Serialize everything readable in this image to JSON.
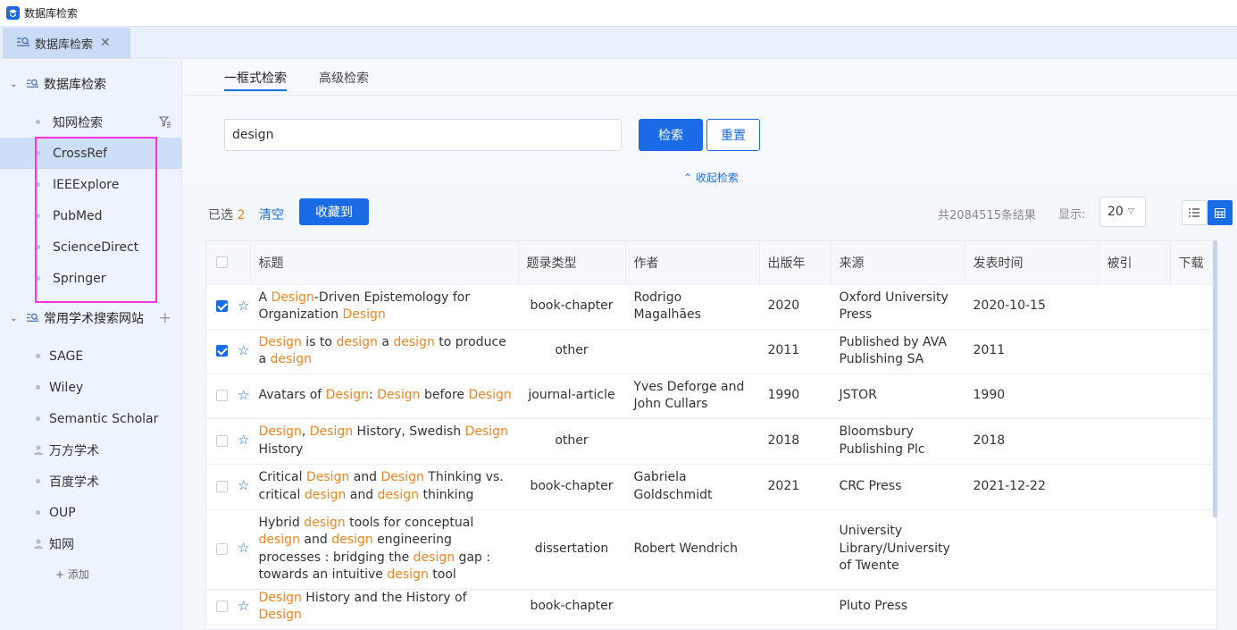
{
  "app": {
    "title": "数据库检索"
  },
  "tabs": [
    {
      "label": "数据库检索",
      "close": "✕"
    }
  ],
  "sidebar": {
    "group1": {
      "label": "数据库检索",
      "chevron": "⌄"
    },
    "items1": [
      {
        "label": "知网检索"
      },
      {
        "label": "CrossRef"
      },
      {
        "label": "IEEExplore"
      },
      {
        "label": "PubMed"
      },
      {
        "label": "ScienceDirect"
      },
      {
        "label": "Springer"
      }
    ],
    "group2": {
      "label": "常用学术搜索网站",
      "chevron": "⌄",
      "plus": "+"
    },
    "items2": [
      {
        "label": "SAGE"
      },
      {
        "label": "Wiley"
      },
      {
        "label": "Semantic Scholar"
      },
      {
        "label": "万方学术"
      },
      {
        "label": "百度学术"
      },
      {
        "label": "OUP"
      },
      {
        "label": "知网"
      }
    ],
    "add_label": "+ 添加"
  },
  "search": {
    "tabs": [
      {
        "label": "一框式检索"
      },
      {
        "label": "高级检索"
      }
    ],
    "query": "design",
    "search_button": "检索",
    "reset_button": "重置",
    "collapse_link": "⌃ 收起检索"
  },
  "toolbar": {
    "selected_label": "已选",
    "selected_count": "2",
    "clear": "清空",
    "favorite": "收藏到",
    "total": "共2084515条结果",
    "show_label": "显示:",
    "page_size": "20"
  },
  "table": {
    "headers": [
      "标题",
      "题录类型",
      "作者",
      "出版年",
      "来源",
      "发表时间",
      "被引",
      "下载"
    ],
    "rows": [
      {
        "checked": true,
        "title": [
          [
            "A ",
            0
          ],
          [
            "Design",
            1
          ],
          [
            "-Driven Epistemology for Organization ",
            0
          ],
          [
            "Design",
            1
          ]
        ],
        "type": "book-chapter",
        "author": "Rodrigo Magalhães",
        "year": "2020",
        "source": "Oxford University Press",
        "date": "2020-10-15",
        "cited": "",
        "download": ""
      },
      {
        "checked": true,
        "title": [
          [
            "Design",
            1
          ],
          [
            " is to ",
            0
          ],
          [
            "design",
            1
          ],
          [
            " a ",
            0
          ],
          [
            "design",
            1
          ],
          [
            " to produce a ",
            0
          ],
          [
            "design",
            1
          ]
        ],
        "type": "other",
        "author": "",
        "year": "2011",
        "source": "Published by AVA Publishing SA",
        "date": "2011",
        "cited": "",
        "download": ""
      },
      {
        "checked": false,
        "title": [
          [
            "Avatars of ",
            0
          ],
          [
            "Design",
            1
          ],
          [
            ": ",
            0
          ],
          [
            "Design",
            1
          ],
          [
            " before ",
            0
          ],
          [
            "Design",
            1
          ]
        ],
        "type": "journal-article",
        "author": "Yves Deforge and John Cullars",
        "year": "1990",
        "source": "JSTOR",
        "date": "1990",
        "cited": "",
        "download": ""
      },
      {
        "checked": false,
        "title": [
          [
            "Design",
            1
          ],
          [
            ", ",
            0
          ],
          [
            "Design",
            1
          ],
          [
            " History, Swedish ",
            0
          ],
          [
            "Design",
            1
          ],
          [
            " History",
            0
          ]
        ],
        "type": "other",
        "author": "",
        "year": "2018",
        "source": "Bloomsbury Publishing Plc",
        "date": "2018",
        "cited": "",
        "download": ""
      },
      {
        "checked": false,
        "title": [
          [
            "Critical ",
            0
          ],
          [
            "Design",
            1
          ],
          [
            " and ",
            0
          ],
          [
            "Design",
            1
          ],
          [
            " Thinking vs. critical ",
            0
          ],
          [
            "design",
            1
          ],
          [
            " and ",
            0
          ],
          [
            "design",
            1
          ],
          [
            " thinking",
            0
          ]
        ],
        "type": "book-chapter",
        "author": "Gabriela Goldschmidt",
        "year": "2021",
        "source": "CRC Press",
        "date": "2021-12-22",
        "cited": "",
        "download": ""
      },
      {
        "checked": false,
        "title": [
          [
            "Hybrid ",
            0
          ],
          [
            "design",
            1
          ],
          [
            " tools for conceptual ",
            0
          ],
          [
            "design",
            1
          ],
          [
            " and ",
            0
          ],
          [
            "design",
            1
          ],
          [
            " engineering processes : bridging the ",
            0
          ],
          [
            "design",
            1
          ],
          [
            " gap : towards an intuitive ",
            0
          ],
          [
            "design",
            1
          ],
          [
            " tool",
            0
          ]
        ],
        "type": "dissertation",
        "author": "Robert Wendrich",
        "year": "",
        "source": "University Library/University of Twente",
        "date": "",
        "cited": "",
        "download": ""
      },
      {
        "checked": false,
        "title": [
          [
            "Design",
            1
          ],
          [
            " History and the History of ",
            0
          ],
          [
            "Design",
            1
          ]
        ],
        "type": "book-chapter",
        "author": "",
        "year": "",
        "source": "Pluto Press",
        "date": "",
        "cited": "",
        "download": ""
      }
    ]
  },
  "colors": {
    "accent": "#1a6ce6",
    "highlight": "#f0841e",
    "annotation": "#ff33dd"
  }
}
